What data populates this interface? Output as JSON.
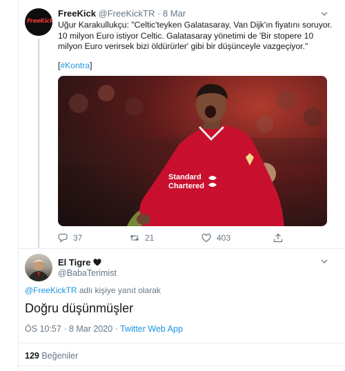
{
  "tweet": {
    "avatar_text": "FreeKick",
    "name": "FreeKick",
    "handle": "@FreeKickTR",
    "separator": "·",
    "date": "8 Mar",
    "lines": [
      "Uğur Karakullukçu: \"Celtic'teyken Galatasaray, Van Dijk'ın fiyatını soruyor.",
      "10 milyon Euro istiyor Celtic. Galatasaray yönetimi de 'Bir stopere 10",
      "milyon Euro verirsek bizi öldürürler' gibi bir düşünceyle vazgeçiyor.\""
    ],
    "hashtag_open": "[",
    "hashtag": "#Kontra",
    "hashtag_close": "]",
    "photo": {
      "jersey_text_line1": "Standard",
      "jersey_text_line2": "Chartered"
    },
    "actions": {
      "replies": "37",
      "retweets": "21",
      "likes": "403"
    }
  },
  "reply": {
    "name": "El Tigre",
    "handle": "@BabaTerimist",
    "replying_to_user": "@FreeKickTR",
    "replying_to_suffix": "adlı kişiye yanıt olarak",
    "text": "Doğru düşünmüşler",
    "time": "ÖS 10:57",
    "separator": "·",
    "date": "8 Mar 2020",
    "source": "Twitter Web App",
    "like_count": "129",
    "like_label": "Beğeniler"
  },
  "colors": {
    "link": "#1b95e0",
    "secondary": "#657786",
    "divider": "#e6ecf0",
    "thread": "#ccd6dd"
  },
  "icons": [
    "chevron-down-icon",
    "reply-icon",
    "retweet-icon",
    "like-icon",
    "share-icon",
    "black-heart-icon"
  ]
}
